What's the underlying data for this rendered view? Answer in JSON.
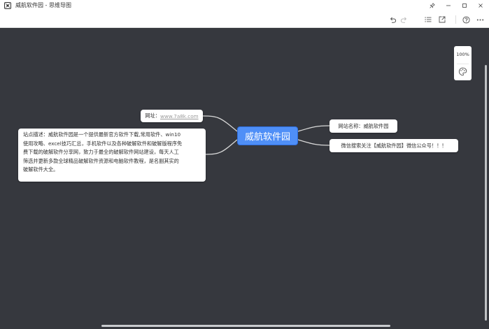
{
  "window": {
    "title": "威航软件园 - 思维导图"
  },
  "toolbar": {
    "undo_icon": "undo-icon",
    "redo_icon": "redo-icon",
    "outline_icon": "list-icon",
    "export_icon": "export-icon",
    "help_icon": "help-icon",
    "more_icon": "more-icon"
  },
  "zoom": {
    "level": "100%"
  },
  "mindmap": {
    "root": "威航软件园",
    "left": [
      {
        "prefix": "网址：",
        "link": "www.7a8k.com"
      },
      {
        "lines": [
          "站点描述：威航软件园是一个提供最新官方软件下载,常用软件、win10",
          "使用攻略、excel技巧汇总，手机软件以及各种破解软件和破解版程序免",
          "费下载的破解软件分享网，致力于最全的破解软件网站建设，每天人工",
          "筛选并更新多款全球精品破解软件资源和电脑软件教程，是名副其实的",
          "破解软件大全。"
        ]
      }
    ],
    "right": [
      {
        "text": "网站名称：威航软件园"
      },
      {
        "text": "微信搜索关注【威航软件园】微信公众号！！！"
      }
    ]
  },
  "colors": {
    "canvas": "#36383e",
    "root_fill": "#4f8ff7",
    "connector": "#d8d8d8"
  }
}
